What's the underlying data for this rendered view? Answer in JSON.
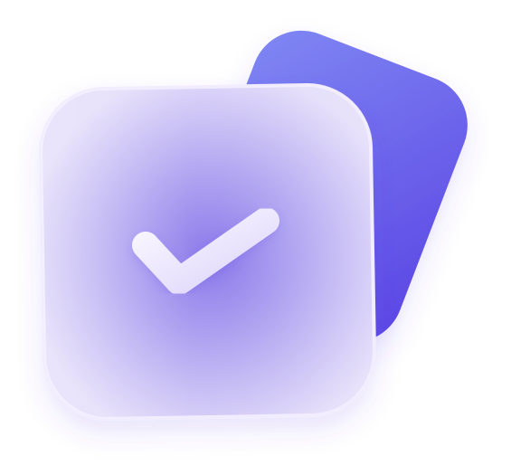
{
  "icon": {
    "name": "checkmark-icon",
    "colors": {
      "back_tile_light": "#7E84F2",
      "back_tile_dark": "#5B45E6",
      "front_tile_light": "#E4DEFA",
      "front_tile_mid": "#B5AAF0",
      "front_tile_glow": "#8C7BEA",
      "check_light": "#F7F5FF",
      "check_dark": "#D9D1FA",
      "background": "#FFFFFF"
    }
  }
}
